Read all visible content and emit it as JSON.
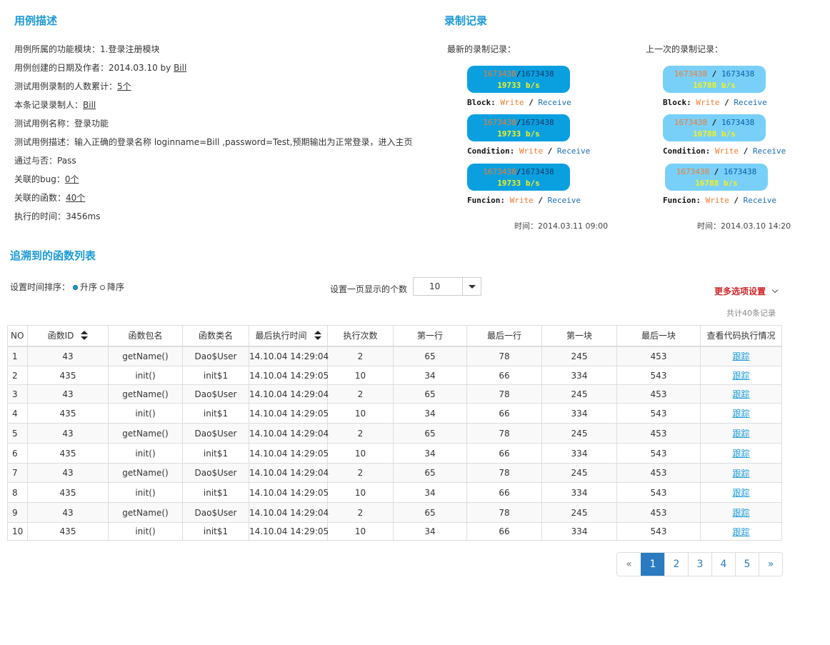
{
  "case_desc": {
    "title": "用例描述",
    "rows": [
      {
        "label": "用例所属的功能模块：",
        "value": "1.登录注册模块",
        "link": ""
      },
      {
        "label": "用例创建的日期及作者：",
        "value": "2014.03.10 by ",
        "link": "Bill"
      },
      {
        "label": "测试用例录制的人数累计：",
        "value": "",
        "link": "5个"
      },
      {
        "label": "本条记录录制人：",
        "value": "",
        "link": "Bill"
      },
      {
        "label": "测试用例名称：",
        "value": "登录功能",
        "link": ""
      },
      {
        "label": "测试用例描述：",
        "value": "输入正确的登录名称 loginname=Bill ,password=Test,预期输出为正常登录，进入主页",
        "link": ""
      },
      {
        "label": "通过与否：",
        "value": "Pass",
        "link": ""
      },
      {
        "label": "关联的bug：",
        "value": "",
        "link": "0个"
      },
      {
        "label": "关联的函数：",
        "value": "",
        "link": "40个"
      },
      {
        "label": "执行的时间：",
        "value": "3456ms",
        "link": ""
      }
    ]
  },
  "records": {
    "title": "录制记录",
    "latest": {
      "heading": "最新的录制记录：",
      "time": "时间：2014.03.11 09:00",
      "items": [
        {
          "write": "1673438",
          "sep": "/",
          "receive": "1673438",
          "rate": "19733 b/s",
          "key": "Block",
          "colon": ":",
          "write_label": "Write",
          "slash": "/",
          "receive_label": "Receive"
        },
        {
          "write": "1673438",
          "sep": "/",
          "receive": "1673438",
          "rate": "19733 b/s",
          "key": "Condition",
          "colon": ":",
          "write_label": "Write",
          "slash": "/",
          "receive_label": "Receive"
        },
        {
          "write": "1673438",
          "sep": "/",
          "receive": "1673438",
          "rate": "19733 b/s",
          "key": "Funcion",
          "colon": ":",
          "write_label": "Write",
          "slash": "/",
          "receive_label": "Receive"
        }
      ]
    },
    "previous": {
      "heading": "上一次的录制记录：",
      "time": "时间：2014.03.10 14:20",
      "items": [
        {
          "write": "1673438",
          "sep": " / ",
          "receive": "1673438",
          "rate": "16788 b/s",
          "key": "Block",
          "colon": ":",
          "write_label": "Write",
          "slash": "/",
          "receive_label": "Receive"
        },
        {
          "write": "1673438",
          "sep": " / ",
          "receive": "1673438",
          "rate": "16788 b/s",
          "key": "Condition",
          "colon": ":",
          "write_label": "Write",
          "slash": "/",
          "receive_label": "Receive"
        },
        {
          "write": "1673438",
          "sep": " / ",
          "receive": "1673438",
          "rate": "16788 b/s",
          "key": "Funcion",
          "colon": ":",
          "write_label": "Write",
          "slash": "/",
          "receive_label": "Receive"
        }
      ]
    }
  },
  "func_list": {
    "title": "追溯到的函数列表",
    "sort_label": "设置时间排序：",
    "asc": "升序",
    "desc": "降序",
    "perpage_label": "设置一页显示的个数",
    "perpage_value": "10",
    "more_options": "更多选项设置",
    "total": "共计40条记录",
    "columns": [
      "NO",
      "函数ID",
      "函数包名",
      "函数类名",
      "最后执行时间",
      "执行次数",
      "第一行",
      "最后一行",
      "第一块",
      "最后一块",
      "查看代码执行情况"
    ],
    "rows": [
      [
        "1",
        "43",
        "getName()",
        "Dao$User",
        "14.10.04 14:29:04",
        "2",
        "65",
        "78",
        "245",
        "453",
        "跟踪"
      ],
      [
        "2",
        "435",
        "init()",
        "init$1",
        "14.10.04 14:29:05",
        "10",
        "34",
        "66",
        "334",
        "543",
        "跟踪"
      ],
      [
        "3",
        "43",
        "getName()",
        "Dao$User",
        "14.10.04 14:29:04",
        "2",
        "65",
        "78",
        "245",
        "453",
        "跟踪"
      ],
      [
        "4",
        "435",
        "init()",
        "init$1",
        "14.10.04 14:29:05",
        "10",
        "34",
        "66",
        "334",
        "543",
        "跟踪"
      ],
      [
        "5",
        "43",
        "getName()",
        "Dao$User",
        "14.10.04 14:29:04",
        "2",
        "65",
        "78",
        "245",
        "453",
        "跟踪"
      ],
      [
        "6",
        "435",
        "init()",
        "init$1",
        "14.10.04 14:29:05",
        "10",
        "34",
        "66",
        "334",
        "543",
        "跟踪"
      ],
      [
        "7",
        "43",
        "getName()",
        "Dao$User",
        "14.10.04 14:29:04",
        "2",
        "65",
        "78",
        "245",
        "453",
        "跟踪"
      ],
      [
        "8",
        "435",
        "init()",
        "init$1",
        "14.10.04 14:29:05",
        "10",
        "34",
        "66",
        "334",
        "543",
        "跟踪"
      ],
      [
        "9",
        "43",
        "getName()",
        "Dao$User",
        "14.10.04 14:29:04",
        "2",
        "65",
        "78",
        "245",
        "453",
        "跟踪"
      ],
      [
        "10",
        "435",
        "init()",
        "init$1",
        "14.10.04 14:29:05",
        "10",
        "34",
        "66",
        "334",
        "543",
        "跟踪"
      ]
    ]
  },
  "pagination": {
    "prev": "«",
    "pages": [
      "1",
      "2",
      "3",
      "4",
      "5"
    ],
    "next": "»",
    "active": "1"
  },
  "colors": {
    "accent": "#1a9ad6",
    "warn": "#d0262a",
    "pill_dark": "#0aa0e0",
    "pill_light": "#78d0f8"
  }
}
